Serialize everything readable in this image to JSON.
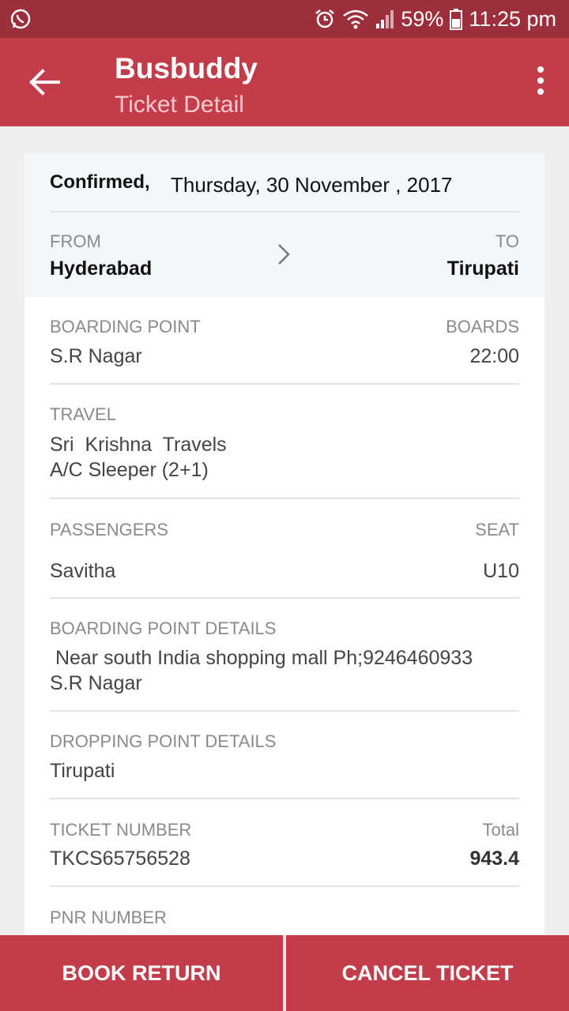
{
  "status_bar": {
    "battery": "59%",
    "time": "11:25 pm",
    "icons": [
      "whatsapp-icon",
      "alarm-icon",
      "wifi-icon",
      "signal-icon",
      "battery-icon"
    ]
  },
  "app_bar": {
    "title": "Busbuddy",
    "subtitle": "Ticket Detail",
    "color": "#c33c4a"
  },
  "ticket": {
    "status": "Confirmed,",
    "date": "Thursday, 30 November , 2017",
    "from_label": "FROM",
    "from_value": "Hyderabad",
    "to_label": "TO",
    "to_value": "Tirupati",
    "boarding_point_label": "BOARDING POINT",
    "boarding_point_value": "S.R Nagar",
    "boards_label": "BOARDS",
    "boards_value": "22:00",
    "travel_label": "TRAVEL",
    "travel_name": "Sri  Krishna  Travels",
    "travel_type": "A/C Sleeper (2+1)",
    "passengers_label": "PASSENGERS",
    "passenger_name": "Savitha",
    "seat_label": "SEAT",
    "seat_value": "U10",
    "bp_details_label": "BOARDING POINT DETAILS",
    "bp_details_line1": " Near south India shopping mall Ph;9246460933",
    "bp_details_line2": "S.R Nagar",
    "dp_details_label": "DROPPING POINT DETAILS",
    "dp_details_value": "Tirupati",
    "ticket_number_label": "TICKET NUMBER",
    "ticket_number_value": "TKCS65756528",
    "total_label": "Total",
    "total_value": "943.4",
    "pnr_label": "PNR NUMBER"
  },
  "actions": {
    "book_return": "BOOK RETURN",
    "cancel_ticket": "CANCEL TICKET"
  }
}
